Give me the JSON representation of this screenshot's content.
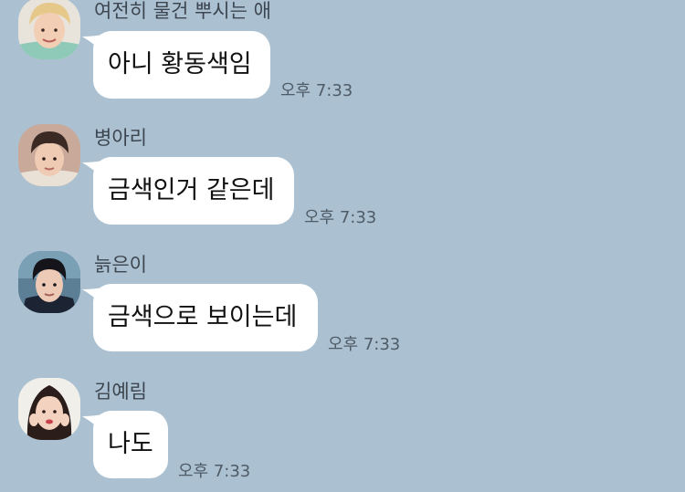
{
  "messages": [
    {
      "sender": "여전히 물건 뿌시는 애",
      "text": "아니 황동색임",
      "time": "오후 7:33",
      "avatar": "person-avatar-blond-hair"
    },
    {
      "sender": "병아리",
      "text": "금색인거 같은데",
      "time": "오후 7:33",
      "avatar": "person-avatar-dark-hair"
    },
    {
      "sender": "늙은이",
      "text": "금색으로 보이는데",
      "time": "오후 7:33",
      "avatar": "person-avatar-black-hair"
    },
    {
      "sender": "김예림",
      "text": "나도",
      "time": "오후 7:33",
      "avatar": "person-avatar-long-hair"
    }
  ],
  "colors": {
    "background": "#abc1d1",
    "bubble": "#ffffff",
    "sender_text": "#3d4650",
    "time_text": "#4f5b66"
  }
}
